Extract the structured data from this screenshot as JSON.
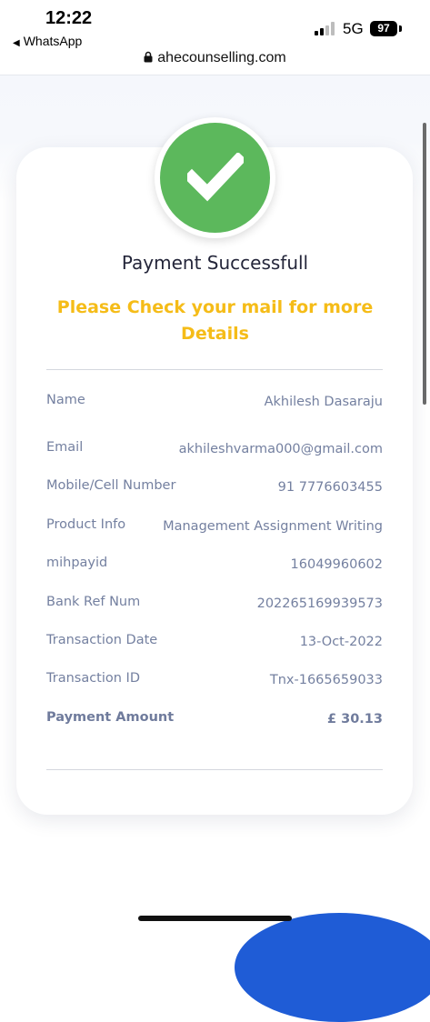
{
  "status_bar": {
    "time": "12:22",
    "back_app": "WhatsApp",
    "network": "5G",
    "battery": "97",
    "url": "ahecounselling.com"
  },
  "payment": {
    "title": "Payment Successfull",
    "notice": "Please Check your mail for more Details",
    "details": [
      {
        "label": "Name",
        "value": "Akhilesh Dasaraju"
      },
      {
        "label": "Email",
        "value": "akhileshvarma000@gmail.com"
      },
      {
        "label": "Mobile/Cell Number",
        "value": "91 7776603455"
      },
      {
        "label": "Product Info",
        "value": "Management Assignment Writing"
      },
      {
        "label": "mihpayid",
        "value": "16049960602"
      },
      {
        "label": "Bank Ref Num",
        "value": "202265169939573"
      },
      {
        "label": "Transaction Date",
        "value": "13-Oct-2022"
      },
      {
        "label": "Transaction ID",
        "value": "Tnx-1665659033"
      },
      {
        "label": "Payment Amount",
        "value": "£ 30.13"
      }
    ]
  },
  "colors": {
    "success_green": "#5cb85c",
    "notice_yellow": "#f5bc18",
    "detail_text": "#7480a0"
  }
}
